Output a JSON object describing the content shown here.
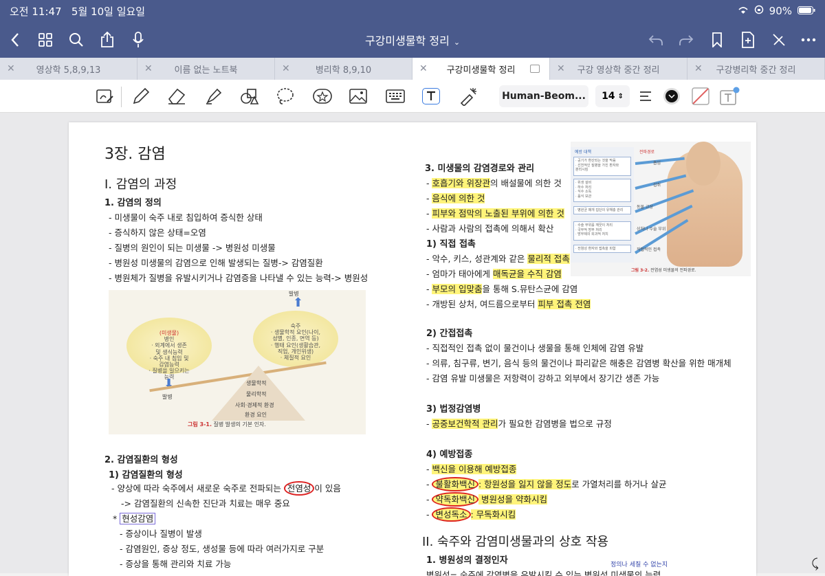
{
  "status": {
    "time": "오전 11:47",
    "date": "5월 10일 일요일",
    "battery": "90%"
  },
  "nav": {
    "title": "구강미생물학 정리"
  },
  "tabs": [
    {
      "label": "영상학 5,8,9,13"
    },
    {
      "label": "이름 없는 노트북"
    },
    {
      "label": "병리학 8,9,10"
    },
    {
      "label": "구강미생물학 정리"
    },
    {
      "label": "구강 영상학 중간 정리"
    },
    {
      "label": "구강병리학 중간 정리"
    }
  ],
  "toolbar": {
    "font": "Human-Beom...",
    "size": "14",
    "color": "#111111"
  },
  "left": {
    "chapter": "3장. 감염",
    "section1": "I. 감염의 과정",
    "sub1": "1. 감염의 정의",
    "lines1": [
      "- 미생물이 숙주 내로 침입하여 증식한 상태",
      "- 증식하지 않은 상태=오염",
      "- 질병의 원인이 되는 미생물 -> 병원성 미생물",
      "- 병원성 미생물의 감염으로 인해 발생되는 질병-> 감염질환",
      "- 병원체가 질병을 유발시키거나 감염증을 나타낼 수 있는 능력-> 병원성"
    ],
    "fig": {
      "left_oval_title": "(미생물)",
      "left_oval": [
        "병인",
        "· 외계에서 생존",
        "및 생식능력",
        "· 숙주 내 침입 및",
        "감염능력",
        "· 질병을 일으키는",
        "능력"
      ],
      "right_oval": [
        "숙주",
        "· 생물학적 요인(나이,",
        "성별, 인종, 면역 등)",
        "· 행태 요인(생활습관,",
        "직업, 개인위생)",
        "· 체질적 요인"
      ],
      "up": "발병",
      "down": "발병",
      "levels": [
        "생물학적",
        "물리학적",
        "사회·경제적 환경",
        "환경 요인"
      ],
      "caption_num": "그림 3-1.",
      "caption": "질병 발생의 기본 인자."
    },
    "sub2": "2. 감염질환의 형성",
    "sub2a": "1) 감염질환의 형성",
    "l2_1a": "- 양상에 따라 숙주에서 새로운 숙주로 전파되는 ",
    "l2_1b": "전염성",
    "l2_1c": "이 있음",
    "l2_2": "-> 감염질환의 신속한 진단과 치료는 매우 중요",
    "star": "* ",
    "boxed": "현성감염",
    "l2_3": "- 증상이나 질병이 발생",
    "l2_4": "- 감염원인, 증상 정도, 생성물 등에 따라 여러가지로 구분",
    "l2_5": "- 증상을 통해 관리와 치료 가능"
  },
  "right": {
    "h3": "3. 미생물의 감염경로와 관리",
    "r1a": "- ",
    "r1b": "호흡기와 위장관",
    "r1c": "의 배설물에 의한 것",
    "r2": "음식에 의한 것",
    "r3": "피부와 점막의 노출된 부위에 의한 것",
    "r4": "- 사람과 사람의 접촉에 의해서 확산",
    "d1": "1) 직접 접촉",
    "d1a": "- 악수, 키스, 성관계와 같은 ",
    "d1a_hl": "물리적 접촉",
    "d1b": "- 엄마가 태아에게 ",
    "d1b_hl": "매독균을 수직 감염",
    "d1c_hl": "부모의 입맞춤",
    "d1c": "을 통해 S.뮤탄스균에 감염",
    "d1d": "- 개방된 상처, 여드름으로부터 ",
    "d1d_hl": "피부 접촉 전염",
    "d2": "2) 간접접촉",
    "d2a": "- 직접적인 접촉 없이 물건이나 생물을 통해 인체에 감염 유발",
    "d2b": "- 의류, 침구류, 변기, 음식 등의 물건이나 파리같은 해충은 감염병 확산을 위한 매개체",
    "d2c": "- 감염 유발 미생물은 저항력이 강하고 외부에서 장기간 생존 가능",
    "d3": "3) 법정감염병",
    "d3a_hl": "공중보건학적 관리",
    "d3a": "가 필요한 감염병을 법으로 규정",
    "d4": "4) 예방접종",
    "d4a": "백신을 이용해 예방접종",
    "d4b_c": "불활화백신",
    "d4b_hl": ": 항원성을 잃지 않을 정도",
    "d4b": "로 가열처리를 하거나 살균",
    "d4c_c": "약독화백신",
    "d4c_hl": " 병원성을 약화시킴",
    "d4d_c": "변성독소",
    "d4d": ": 무독화시킴",
    "section2": "II. 숙주와 감염미생물과의 상호 작용",
    "sub": "1. 병원성의 결정인자",
    "last": "병원성= 숙주에 감염병을 유발시킬 수 있는 병원성 미생물의 능력",
    "note": "정의나  세칠 수 없는지",
    "fig2": {
      "h_left": "예방 대책",
      "h_right": "전파경로",
      "boxes": [
        "· 공기가 환산되는 것을 막음\n· 선천적인 질병을 가진 환자와\n  분리시킴",
        "· 위생 설비\n· 하수 처리\n· 식수 소독\n· 음식 보관",
        "· 병원균 매개 집단의 유해충 관리",
        "· 수술 부위를 깨끗이 처리\n· 국부적 방부 처리\n· 방부제의 외과적 처치",
        "· 전염성 환자와 접촉을 피함"
      ],
      "labels": [
        "흡입",
        "섭취",
        "동물 교상",
        "상처나 수술 부위",
        "직접적인 접촉"
      ],
      "caption_num": "그림 3-2.",
      "caption": "전염성 미생물의 전파경로."
    }
  }
}
